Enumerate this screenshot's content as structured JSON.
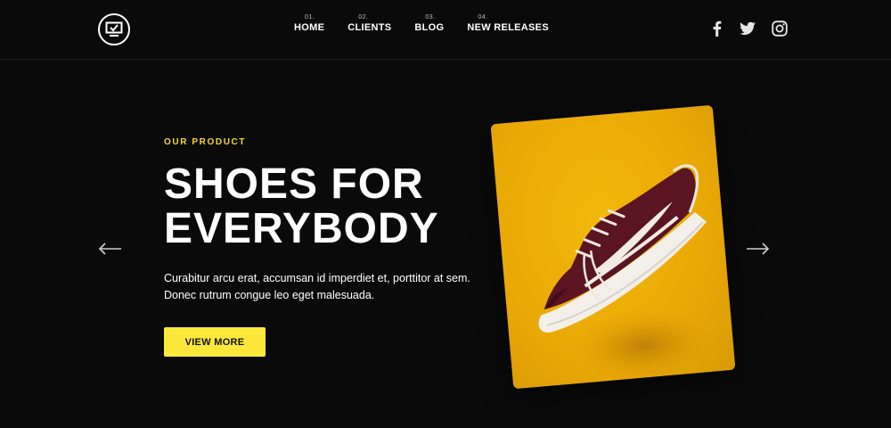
{
  "nav": {
    "items": [
      {
        "num": "01.",
        "label": "HOME"
      },
      {
        "num": "02.",
        "label": "CLIENTS"
      },
      {
        "num": "03.",
        "label": "BLOG"
      },
      {
        "num": "04.",
        "label": "NEW RELEASES"
      }
    ]
  },
  "social": [
    "facebook-icon",
    "twitter-icon",
    "instagram-icon"
  ],
  "hero": {
    "eyebrow": "OUR PRODUCT",
    "title_line1": "SHOES FOR",
    "title_line2": "EVERYBODY",
    "desc_line1": "Curabitur arcu erat, accumsan id imperdiet et, porttitor at sem.",
    "desc_line2": "Donec rutrum congue leo eget malesuada.",
    "cta_label": "VIEW MORE"
  },
  "colors": {
    "background": "#0a0a0b",
    "accent": "#fce83a",
    "eyebrow": "#f5d63c",
    "card": "#eaa906",
    "shoe": "#5a1422"
  }
}
